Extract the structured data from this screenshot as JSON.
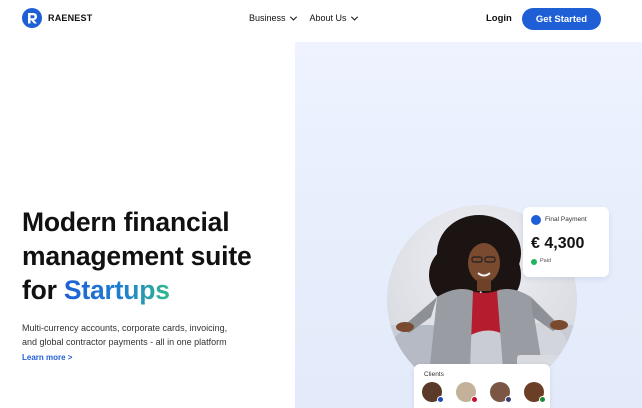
{
  "brand": {
    "name": "RAENEST",
    "color": "#1f5fd6"
  },
  "nav": {
    "items": [
      {
        "label": "Business",
        "icon": "chevron-down-icon"
      },
      {
        "label": "About Us",
        "icon": "chevron-down-icon"
      }
    ],
    "login_label": "Login",
    "cta_label": "Get Started"
  },
  "hero": {
    "headline_line1": "Modern financial",
    "headline_line2": "management suite",
    "headline_line3_prefix": "for ",
    "headline_line3_accent": "Startups",
    "subcopy_line1": "Multi-currency accounts, corporate cards, invoicing,",
    "subcopy_line2": "and global contractor payments - all in one platform",
    "learn_more": "Learn more >"
  },
  "payment_card": {
    "label": "Final Payment",
    "amount": "€ 4,300",
    "status": "Paid",
    "status_color": "#22b35e",
    "icon": "eu-flag-icon"
  },
  "clients_card": {
    "label": "Clients",
    "avatars": [
      {
        "flag": "eu-flag-icon"
      },
      {
        "flag": "uk-flag-icon"
      },
      {
        "flag": "us-flag-icon"
      },
      {
        "flag": "ng-flag-icon"
      }
    ]
  }
}
